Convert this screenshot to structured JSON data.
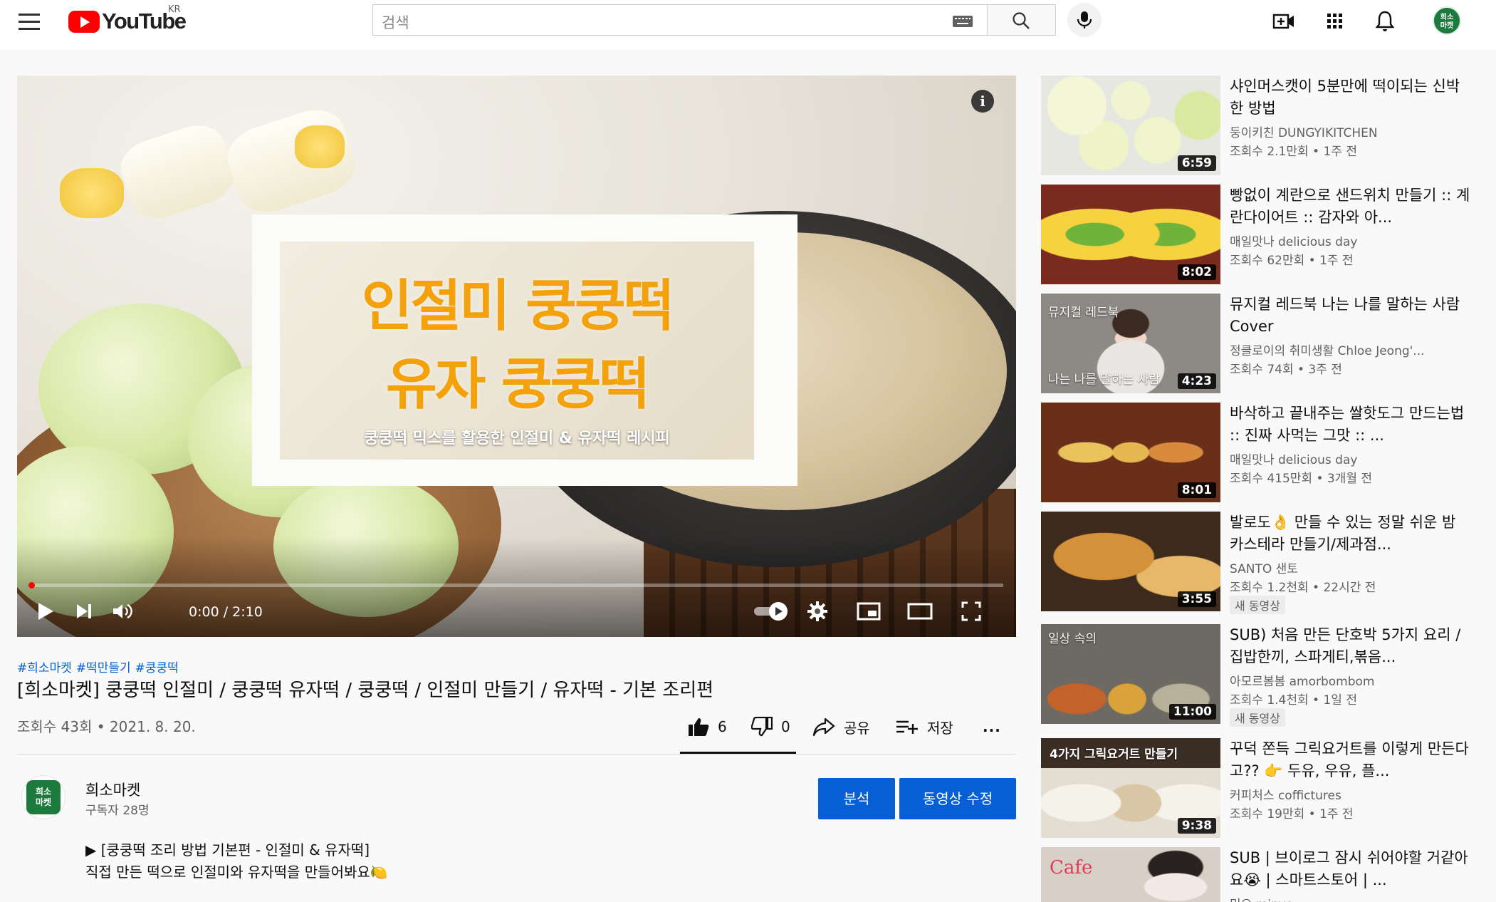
{
  "masthead": {
    "logo_text": "YouTube",
    "region": "KR",
    "search_placeholder": "검색",
    "avatar_text": "희소\n마켓"
  },
  "player": {
    "title_card": {
      "line1": "인절미 쿵쿵떡",
      "line2": "유자 쿵쿵떡",
      "subtitle": "쿵쿵떡 믹스를 활용한 인절미 & 유자떡 레시피"
    },
    "info_icon_glyph": "i",
    "current_time": "0:00",
    "duration": "2:10",
    "progress_fraction": 0.002
  },
  "video": {
    "hashtags": [
      "#희소마켓",
      "#떡만들기",
      "#쿵쿵떡"
    ],
    "title": "[희소마켓] 쿵쿵떡 인절미 / 쿵쿵떡 유자떡 / 쿵쿵떡 / 인절미 만들기 / 유자떡 - 기본 조리편",
    "view_info": "조회수 43회 • 2021. 8. 20.",
    "like_count": "6",
    "dislike_count": "0",
    "share_label": "공유",
    "save_label": "저장",
    "more_label": "..."
  },
  "channel": {
    "avatar_text": "희소\n마켓",
    "name": "희소마켓",
    "subscribers": "구독자 28명",
    "analytics_button": "분석",
    "edit_button": "동영상 수정"
  },
  "description": {
    "line1": "▶ [쿵쿵떡 조리 방법 기본편 - 인절미 & 유자떡]",
    "line2": "직접 만든 떡으로 인절미와 유자떡을 만들어봐요🍋"
  },
  "recommendations": [
    {
      "title": "샤인머스캣이 5분만에 떡이되는 신박한 방법",
      "channel": "둥이키친 DUNGYIKITCHEN",
      "meta": "조회수 2.1만회 • 1주 전",
      "duration": "6:59",
      "badge": ""
    },
    {
      "title": "빵없이 계란으로 샌드위치 만들기 :: 계란다이어트 :: 감자와 아...",
      "channel": "매일맛나 delicious day",
      "meta": "조회수 62만회 • 1주 전",
      "duration": "8:02",
      "badge": ""
    },
    {
      "title": "뮤지컬 레드북 나는 나를 말하는 사람 Cover",
      "channel": "정클로이의 취미생활 Chloe Jeong'...",
      "meta": "조회수 74회 • 3주 전",
      "duration": "4:23",
      "badge": "",
      "thumb_text_top": "뮤지컬 레드북",
      "thumb_text_bottom": "나는 나를 말하는 사람"
    },
    {
      "title": "바삭하고 끝내주는 쌀핫도그 만드는법 :: 진짜 사먹는 그맛 :: ...",
      "channel": "매일맛나 delicious day",
      "meta": "조회수 415만회 • 3개월 전",
      "duration": "8:01",
      "badge": ""
    },
    {
      "title": "발로도👌 만들 수 있는 정말 쉬운 밤 카스테라 만들기/제과점...",
      "channel": "SANTO 샌토",
      "meta": "조회수 1.2천회 • 22시간 전",
      "duration": "3:55",
      "badge": "새 동영상"
    },
    {
      "title": "SUB) 처음 만든 단호박 5가지 요리 / 집밥한끼, 스파게티,볶음...",
      "channel": "아모르봄봄 amorbombom",
      "meta": "조회수 1.4천회 • 1일 전",
      "duration": "11:00",
      "badge": "새 동영상",
      "thumb_text_top": "일상 속의"
    },
    {
      "title": "꾸덕 쫀득 그릭요거트를 이렇게 만든다고?? 👉 두유, 우유, 플...",
      "channel": "커피처스 coffictures",
      "meta": "조회수 19만회 • 1주 전",
      "duration": "9:38",
      "badge": "",
      "thumb_text_top": "4가지 그릭요거트 만들기"
    },
    {
      "title": "SUB | 브이로그 잠시 쉬어야할 거같아요😭 | 스마트스토어 | ...",
      "channel": "민요 minyo",
      "meta": "",
      "duration": "",
      "badge": "",
      "thumb_text_top": "Cafe"
    }
  ],
  "colors": {
    "accent_red": "#ff0000",
    "link_blue": "#065fd4",
    "button_blue": "#065fd4",
    "channel_green": "#1b7a3c",
    "title_card_orange": "#f3a20c"
  },
  "icons": [
    "hamburger-icon",
    "youtube-logo-icon",
    "keyboard-icon",
    "search-icon",
    "mic-icon",
    "create-video-icon",
    "apps-grid-icon",
    "bell-icon",
    "info-icon",
    "play-icon",
    "next-icon",
    "volume-icon",
    "autoplay-toggle-icon",
    "settings-icon",
    "miniplayer-icon",
    "theater-icon",
    "fullscreen-icon",
    "thumbs-up-icon",
    "thumbs-down-icon",
    "share-icon",
    "save-playlist-icon",
    "more-icon"
  ]
}
